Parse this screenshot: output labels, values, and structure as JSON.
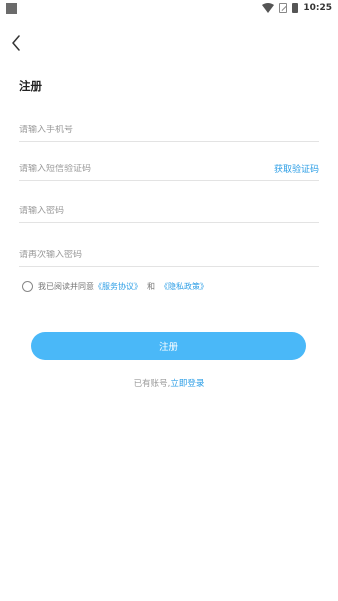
{
  "status_bar": {
    "time": "10:25"
  },
  "page": {
    "title": "注册"
  },
  "form": {
    "phone_placeholder": "请输入手机号",
    "sms_placeholder": "请输入短信验证码",
    "get_code_label": "获取验证码",
    "password_placeholder": "请输入密码",
    "confirm_password_placeholder": "请再次输入密码"
  },
  "agreement": {
    "prefix": "我已阅读并同意",
    "service_link": "《服务协议》",
    "connector": "和",
    "privacy_link": "《隐私政策》"
  },
  "register_button": "注册",
  "login_prompt": {
    "text": "已有账号,",
    "link": "立即登录"
  },
  "colors": {
    "accent": "#2c9ee6",
    "button": "#4ab8f8"
  }
}
